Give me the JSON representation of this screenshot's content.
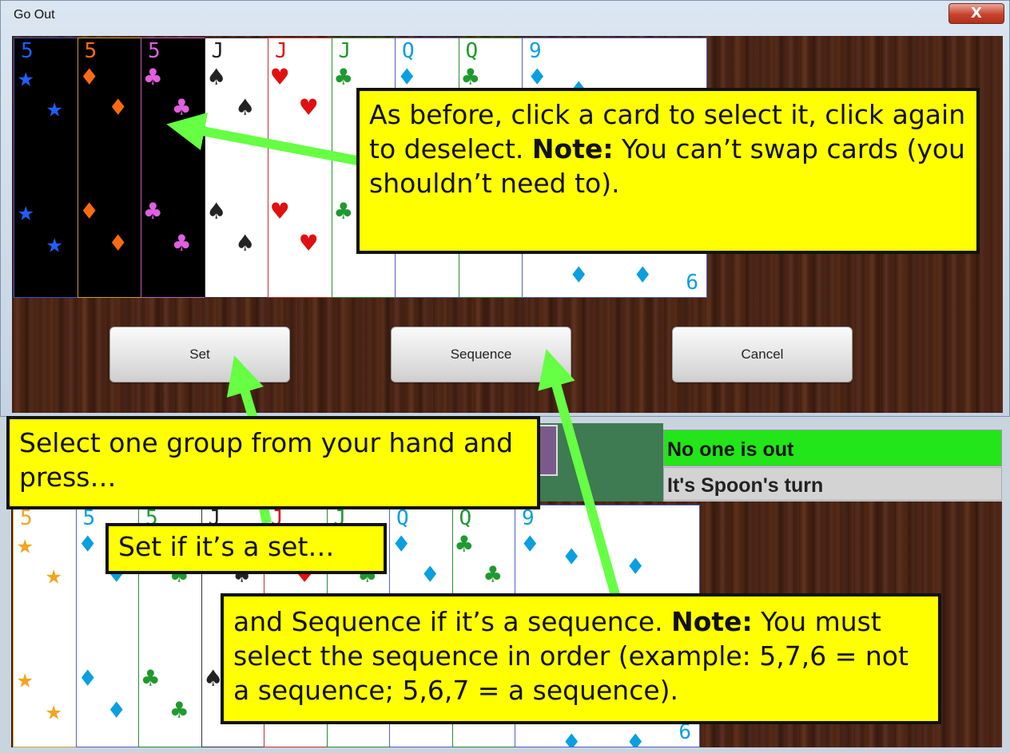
{
  "dialog": {
    "title": "Go Out",
    "close_label": "X",
    "buttons": {
      "set": "Set",
      "sequence": "Sequence",
      "cancel": "Cancel"
    }
  },
  "status": {
    "out_status": "No one is out",
    "turn_status": "It's Spoon's turn"
  },
  "dialog_hand": [
    {
      "rank": "5",
      "suit": "★",
      "face": "black",
      "color": "#1f5fff",
      "border": "#2f55d0",
      "bottom": ""
    },
    {
      "rank": "5",
      "suit": "♦",
      "face": "black",
      "color": "#ff6a10",
      "border": "#c6a52a",
      "bottom": ""
    },
    {
      "rank": "5",
      "suit": "♣",
      "face": "black",
      "color": "#e060e0",
      "border": "#c060c0",
      "bottom": ""
    },
    {
      "rank": "J",
      "suit": "♠",
      "face": "white",
      "color": "#222222",
      "border": "#333333",
      "bottom": ""
    },
    {
      "rank": "J",
      "suit": "♥",
      "face": "white",
      "color": "#e01010",
      "border": "#c03030",
      "bottom": ""
    },
    {
      "rank": "J",
      "suit": "♣",
      "face": "white",
      "color": "#1e9a2e",
      "border": "#2a8a3a",
      "bottom": ""
    },
    {
      "rank": "Q",
      "suit": "♦",
      "face": "white",
      "color": "#0a9fe0",
      "border": "#5060c0",
      "bottom": ""
    },
    {
      "rank": "Q",
      "suit": "♣",
      "face": "white",
      "color": "#1e9a2e",
      "border": "#2a8a3a",
      "bottom": ""
    },
    {
      "rank": "9",
      "suit": "♦",
      "face": "white",
      "color": "#0a9fe0",
      "border": "#5060c0",
      "bottom": "6"
    }
  ],
  "main_hand": [
    {
      "rank": "5",
      "suit": "★",
      "face": "white",
      "color": "#f2a51e",
      "border": "#cfa040",
      "bottom": ""
    },
    {
      "rank": "5",
      "suit": "♦",
      "face": "white",
      "color": "#0a9fe0",
      "border": "#5060c0",
      "bottom": ""
    },
    {
      "rank": "5",
      "suit": "♣",
      "face": "white",
      "color": "#1e9a2e",
      "border": "#2a8a3a",
      "bottom": ""
    },
    {
      "rank": "J",
      "suit": "♠",
      "face": "white",
      "color": "#222222",
      "border": "#333333",
      "bottom": ""
    },
    {
      "rank": "J",
      "suit": "♥",
      "face": "white",
      "color": "#e01010",
      "border": "#c03030",
      "bottom": ""
    },
    {
      "rank": "J",
      "suit": "♣",
      "face": "white",
      "color": "#1e9a2e",
      "border": "#2a8a3a",
      "bottom": ""
    },
    {
      "rank": "Q",
      "suit": "♦",
      "face": "white",
      "color": "#0a9fe0",
      "border": "#5060c0",
      "bottom": ""
    },
    {
      "rank": "Q",
      "suit": "♣",
      "face": "white",
      "color": "#1e9a2e",
      "border": "#2a8a3a",
      "bottom": ""
    },
    {
      "rank": "9",
      "suit": "♦",
      "face": "white",
      "color": "#0a9fe0",
      "border": "#5060c0",
      "bottom": "6"
    }
  ],
  "callouts": {
    "select_card": {
      "pre": "As before, click a card to select it, click again to deselect. ",
      "note": "Note:",
      "post": " You can’t swap cards (you shouldn’t need to)."
    },
    "select_group": {
      "text": "Select one group from your hand and press…"
    },
    "set_hint": {
      "text": "Set if it’s a set…"
    },
    "sequence_hint": {
      "pre": "and Sequence if it’s a sequence. ",
      "note": "Note:",
      "post": " You must select the sequence in order (example: 5,7,6 = not a sequence; 5,6,7 = a sequence)."
    }
  },
  "colors": {
    "callout_bg": "#ffff00",
    "arrow": "#66ff44",
    "status_green": "#22e51a"
  }
}
